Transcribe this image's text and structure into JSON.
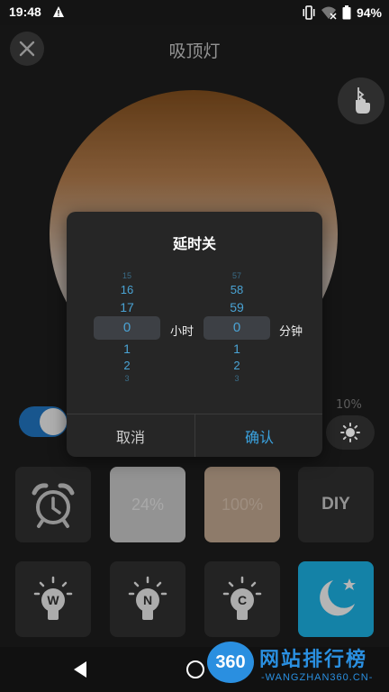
{
  "status_bar": {
    "time": "19:48",
    "battery": "94%"
  },
  "header": {
    "title": "吸顶灯"
  },
  "controls": {
    "brightness_percent": "10%",
    "power_on": true
  },
  "tiles": {
    "row1": [
      {
        "kind": "alarm-icon"
      },
      {
        "label": "24%",
        "color": "#bdbdbd"
      },
      {
        "label": "100%",
        "color": "#b79e88"
      },
      {
        "label": "DIY"
      }
    ],
    "row2": [
      {
        "letter": "W"
      },
      {
        "letter": "N"
      },
      {
        "letter": "C"
      },
      {
        "kind": "moon-icon",
        "color": "#1aa7d6"
      }
    ]
  },
  "dialog": {
    "title": "延时关",
    "hours": {
      "above": [
        "15",
        "16",
        "17"
      ],
      "selected": "0",
      "below": [
        "1",
        "2",
        "3"
      ],
      "unit": "小时"
    },
    "minutes": {
      "above": [
        "57",
        "58",
        "59"
      ],
      "selected": "0",
      "below": [
        "1",
        "2",
        "3"
      ],
      "unit": "分钟"
    },
    "cancel": "取消",
    "confirm": "确认"
  },
  "watermark": {
    "badge": "360",
    "name": "网站排行榜",
    "url": "-WANGZHAN360.CN-"
  }
}
